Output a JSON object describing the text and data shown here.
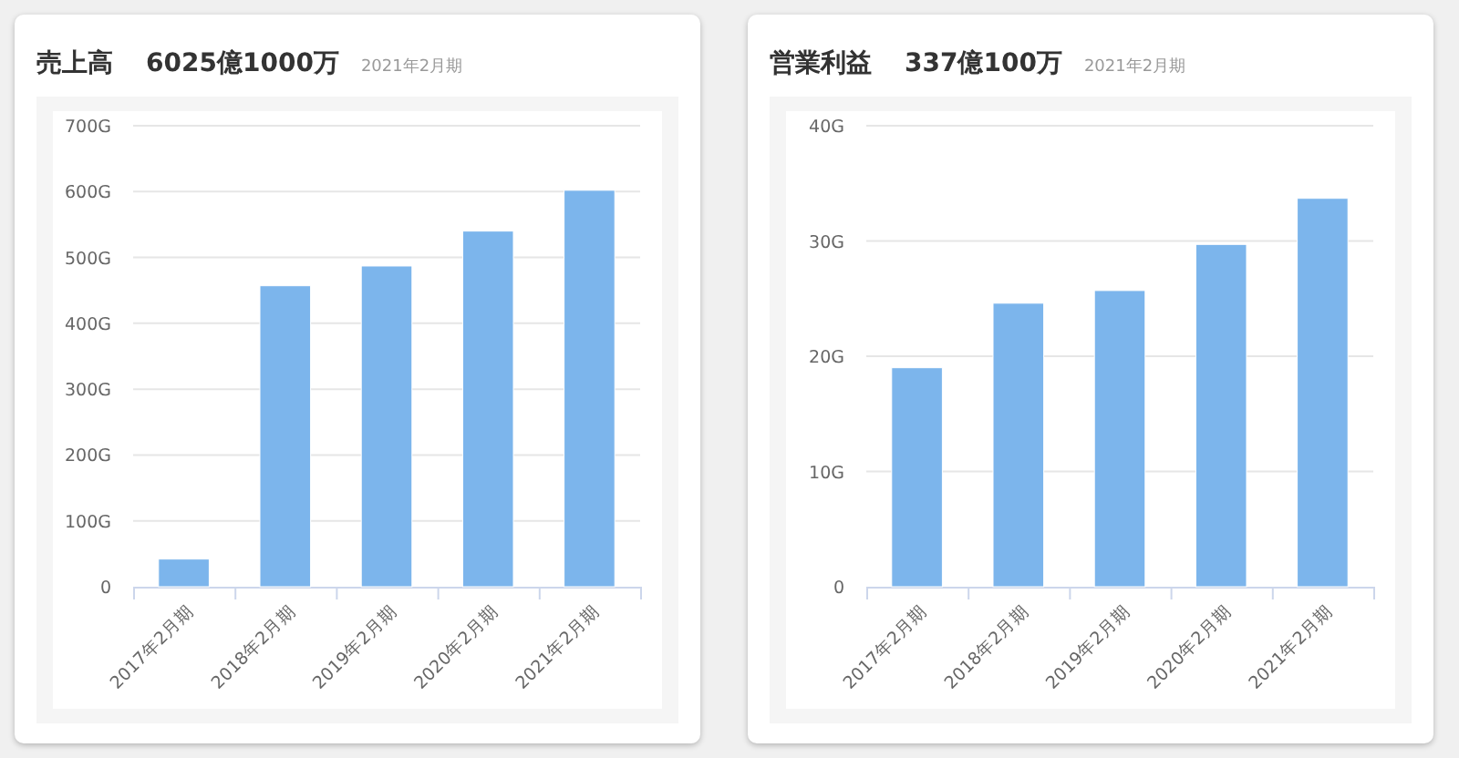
{
  "cards": [
    {
      "title": "売上高",
      "value": "6025億1000万",
      "period": "2021年2月期",
      "chart_data": {
        "type": "bar",
        "categories": [
          "2017年2月期",
          "2018年2月期",
          "2019年2月期",
          "2020年2月期",
          "2021年2月期"
        ],
        "series": [
          {
            "color": "#7cb5ec",
            "values": [
              42,
              457,
              487,
              540,
              602
            ]
          }
        ],
        "grid": true,
        "ylim": [
          0,
          700
        ],
        "yticks": [
          {
            "value": 0,
            "label": "0"
          },
          {
            "value": 100,
            "label": "100G"
          },
          {
            "value": 200,
            "label": "200G"
          },
          {
            "value": 300,
            "label": "300G"
          },
          {
            "value": 400,
            "label": "400G"
          },
          {
            "value": 500,
            "label": "500G"
          },
          {
            "value": 600,
            "label": "600G"
          },
          {
            "value": 700,
            "label": "700G"
          }
        ]
      }
    },
    {
      "title": "営業利益",
      "value": "337億100万",
      "period": "2021年2月期",
      "chart_data": {
        "type": "bar",
        "categories": [
          "2017年2月期",
          "2018年2月期",
          "2019年2月期",
          "2020年2月期",
          "2021年2月期"
        ],
        "series": [
          {
            "color": "#7cb5ec",
            "values": [
              19.0,
              24.6,
              25.7,
              29.7,
              33.7
            ]
          }
        ],
        "grid": true,
        "ylim": [
          0,
          40
        ],
        "yticks": [
          {
            "value": 0,
            "label": "0"
          },
          {
            "value": 10,
            "label": "10G"
          },
          {
            "value": 20,
            "label": "20G"
          },
          {
            "value": 30,
            "label": "30G"
          },
          {
            "value": 40,
            "label": "40G"
          }
        ]
      }
    }
  ]
}
